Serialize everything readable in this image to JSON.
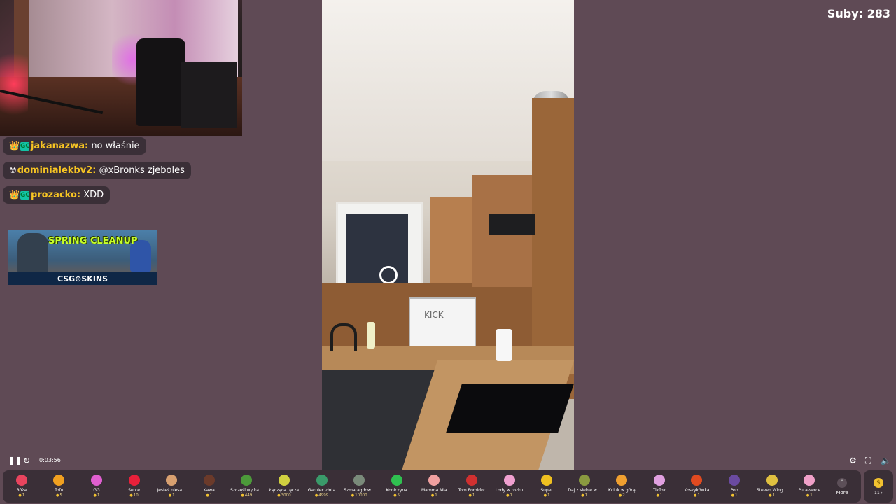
{
  "subs": {
    "label": "Suby: 283"
  },
  "chat": {
    "messages": [
      {
        "badge_icon": "crown-icon",
        "badge2": "GC",
        "user": "jakanazwa",
        "separator": ":",
        "text": " no właśnie"
      },
      {
        "badge_icon": "radioactive-icon",
        "user": "dominialekbv2",
        "separator": ":",
        "text": " @xBronks zjeboles"
      },
      {
        "badge_icon": "crown-icon",
        "badge2": "GC",
        "user": "prozacko",
        "separator": ":",
        "text": " XDD"
      }
    ],
    "ad": {
      "title": "SPRING CLEANUP",
      "brand": "CSG⊙SKINS"
    }
  },
  "player": {
    "time": "0:03:56",
    "icons": [
      "pause-icon",
      "replay-icon",
      "settings-icon",
      "fullscreen-icon",
      "volume-icon"
    ]
  },
  "gifts": [
    {
      "name": "Róża",
      "price": "1",
      "icon": "rose-icon",
      "color": "#e8445e"
    },
    {
      "name": "Tofu",
      "price": "5",
      "icon": "tofu-icon",
      "color": "#f0a020"
    },
    {
      "name": "GG",
      "price": "1",
      "icon": "gg-icon",
      "color": "#e05fd0"
    },
    {
      "name": "Serce",
      "price": "10",
      "icon": "heart-icon",
      "color": "#e8203a"
    },
    {
      "name": "Jesteś niesa...",
      "price": "1",
      "icon": "hamster-icon",
      "color": "#d8a070"
    },
    {
      "name": "Kawa",
      "price": "1",
      "icon": "coffee-icon",
      "color": "#6b3a2a"
    },
    {
      "name": "Szczęśliwy ka...",
      "price": "449",
      "icon": "frog-icon",
      "color": "#4c9a3a"
    },
    {
      "name": "Łącząca tęcza",
      "price": "3000",
      "icon": "rainbow-icon",
      "color": "#d0d040"
    },
    {
      "name": "Garniec złota",
      "price": "4999",
      "icon": "pot-icon",
      "color": "#3a9a6a"
    },
    {
      "name": "Szmaragdow...",
      "price": "10000",
      "icon": "emerald-icon",
      "color": "#7a8a7a"
    },
    {
      "name": "Koniczyna",
      "price": "5",
      "icon": "clover-icon",
      "color": "#30c050"
    },
    {
      "name": "Mamma Mia",
      "price": "1",
      "icon": "mammamia-icon",
      "color": "#f0a0a0"
    },
    {
      "name": "Tom Pomidor",
      "price": "1",
      "icon": "tomato-icon",
      "color": "#d03030"
    },
    {
      "name": "Lody w rożku",
      "price": "1",
      "icon": "icecream-icon",
      "color": "#f0a0d0"
    },
    {
      "name": "Super",
      "price": "1",
      "icon": "sunglasses-icon",
      "color": "#f0c020"
    },
    {
      "name": "Daj z siebie w...",
      "price": "1",
      "icon": "ball-icon",
      "color": "#8a9a40"
    },
    {
      "name": "Kciuk w górę",
      "price": "2",
      "icon": "thumbsup-icon",
      "color": "#f0a030"
    },
    {
      "name": "TikTok",
      "price": "1",
      "icon": "tiktok-icon",
      "color": "#e0a0e0"
    },
    {
      "name": "Koszykówka",
      "price": "1",
      "icon": "basketball-icon",
      "color": "#e04a20"
    },
    {
      "name": "Pop",
      "price": "1",
      "icon": "pop-icon",
      "color": "#6a4aa0"
    },
    {
      "name": "Steven Wing...",
      "price": "1",
      "icon": "wing-icon",
      "color": "#e0c040"
    },
    {
      "name": "Puta-serce",
      "price": "1",
      "icon": "pink-heart-icon",
      "color": "#f0a0c8"
    }
  ],
  "more": {
    "label": "More"
  },
  "coins": {
    "value": "11 ›"
  }
}
